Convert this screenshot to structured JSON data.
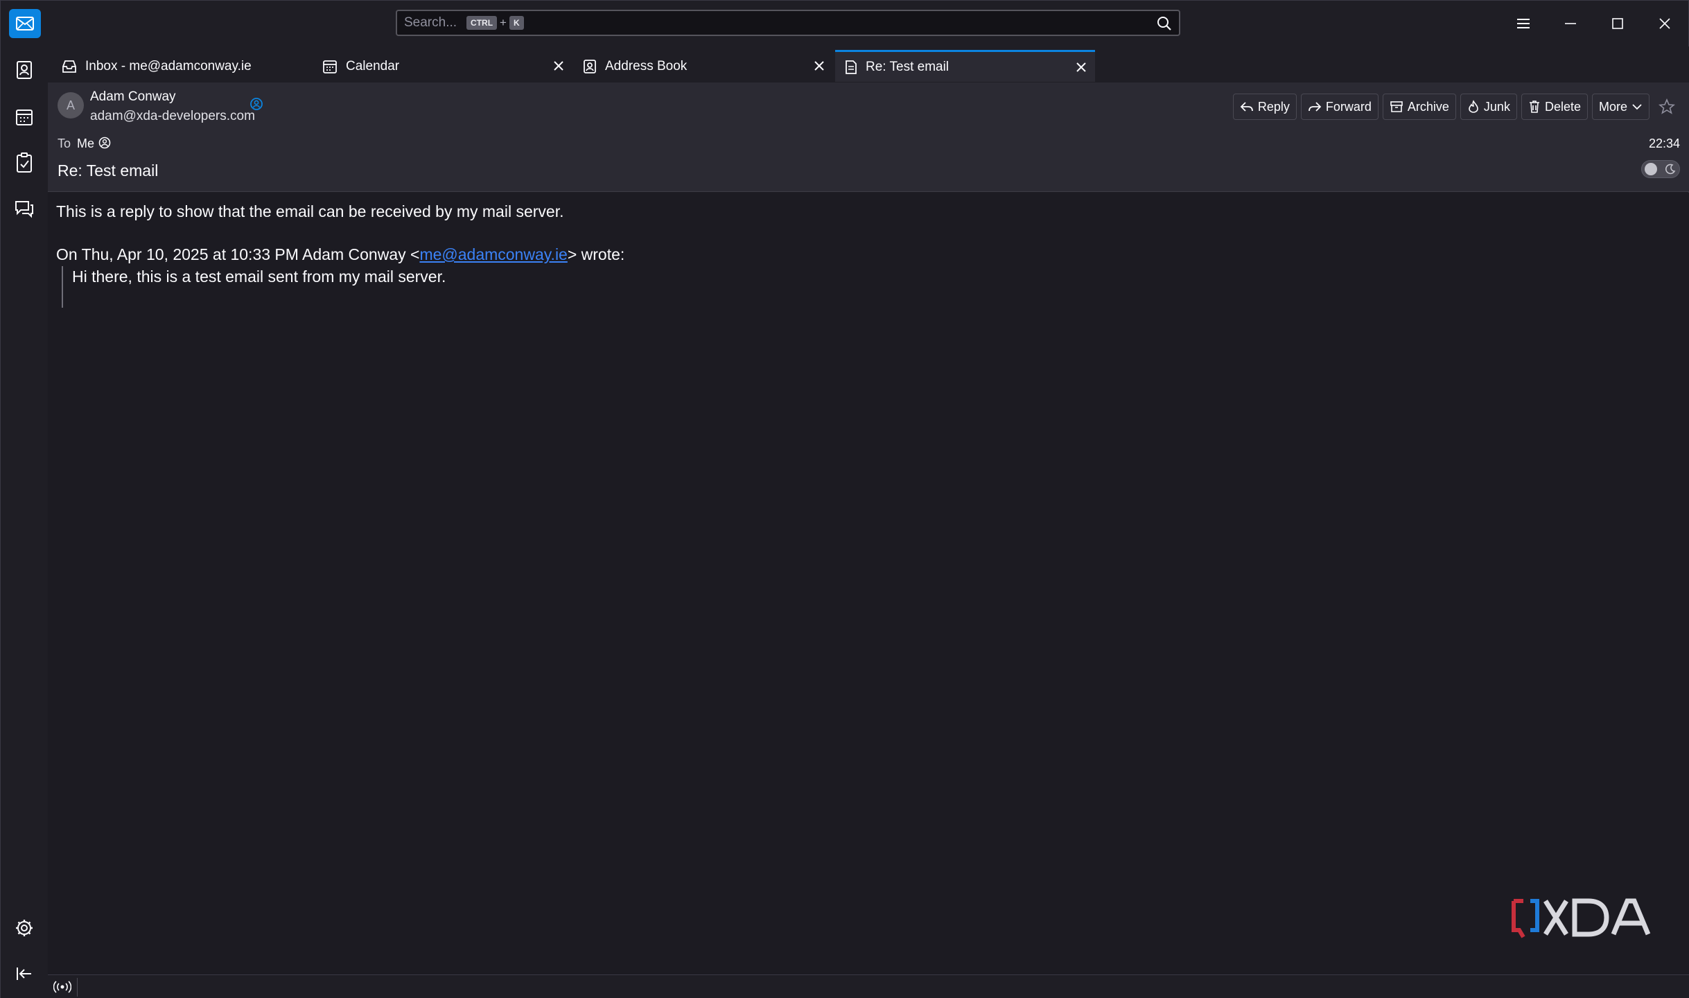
{
  "search": {
    "placeholder": "Search...",
    "kbd_ctrl": "CTRL",
    "kbd_plus": "+",
    "kbd_k": "K"
  },
  "tabs": [
    {
      "label": "Inbox - me@adamconway.ie",
      "icon": "inbox-icon"
    },
    {
      "label": "Calendar",
      "icon": "calendar-icon"
    },
    {
      "label": "Address Book",
      "icon": "address-book-icon"
    },
    {
      "label": "Re: Test email",
      "icon": "message-icon"
    }
  ],
  "message": {
    "avatar_initial": "A",
    "from_name": "Adam Conway",
    "from_email": "adam@xda-developers.com",
    "to_label": "To",
    "to_value": "Me",
    "time": "22:34",
    "subject": "Re: Test email",
    "actions": {
      "reply": "Reply",
      "forward": "Forward",
      "archive": "Archive",
      "junk": "Junk",
      "delete": "Delete",
      "more": "More"
    },
    "body": {
      "paragraph": "This is a reply to show that the email can be received by my mail server.",
      "attribution_prefix": "On Thu, Apr 10, 2025 at 10:33 PM Adam Conway <",
      "attribution_link": "me@adamconway.ie",
      "attribution_suffix": "> wrote:",
      "quote": "Hi there, this is a test email sent from my mail server."
    }
  },
  "colors": {
    "accent": "#0b84e0",
    "link": "#3b82f6",
    "background": "#1c1b22",
    "header": "#2b2a33"
  }
}
